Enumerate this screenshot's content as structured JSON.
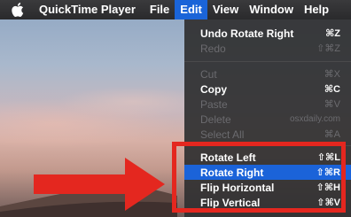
{
  "menubar": {
    "app_name": "QuickTime Player",
    "items": [
      "File",
      "Edit",
      "View",
      "Window",
      "Help"
    ],
    "active_item": "Edit"
  },
  "edit_menu": {
    "items": [
      {
        "label": "Undo Rotate Right",
        "shortcut": "⌘Z",
        "enabled": true
      },
      {
        "label": "Redo",
        "shortcut": "⇧⌘Z",
        "enabled": false
      },
      {
        "label": "Cut",
        "shortcut": "⌘X",
        "enabled": false
      },
      {
        "label": "Copy",
        "shortcut": "⌘C",
        "enabled": true
      },
      {
        "label": "Paste",
        "shortcut": "⌘V",
        "enabled": false
      },
      {
        "label": "Delete",
        "shortcut": "osxdaily.com",
        "enabled": false
      },
      {
        "label": "Select All",
        "shortcut": "⌘A",
        "enabled": false
      },
      {
        "label": "Rotate Left",
        "shortcut": "⇧⌘L",
        "enabled": true
      },
      {
        "label": "Rotate Right",
        "shortcut": "⇧⌘R",
        "enabled": true,
        "selected": true
      },
      {
        "label": "Flip Horizontal",
        "shortcut": "⇧⌘H",
        "enabled": true
      },
      {
        "label": "Flip Vertical",
        "shortcut": "⇧⌘V",
        "enabled": true
      }
    ]
  },
  "annotation": {
    "highlight_color": "#e4271f",
    "arrow_color": "#e4271f"
  },
  "colors": {
    "menubar_bg": "#2a2a2c",
    "selection_blue": "#1b63d9"
  }
}
